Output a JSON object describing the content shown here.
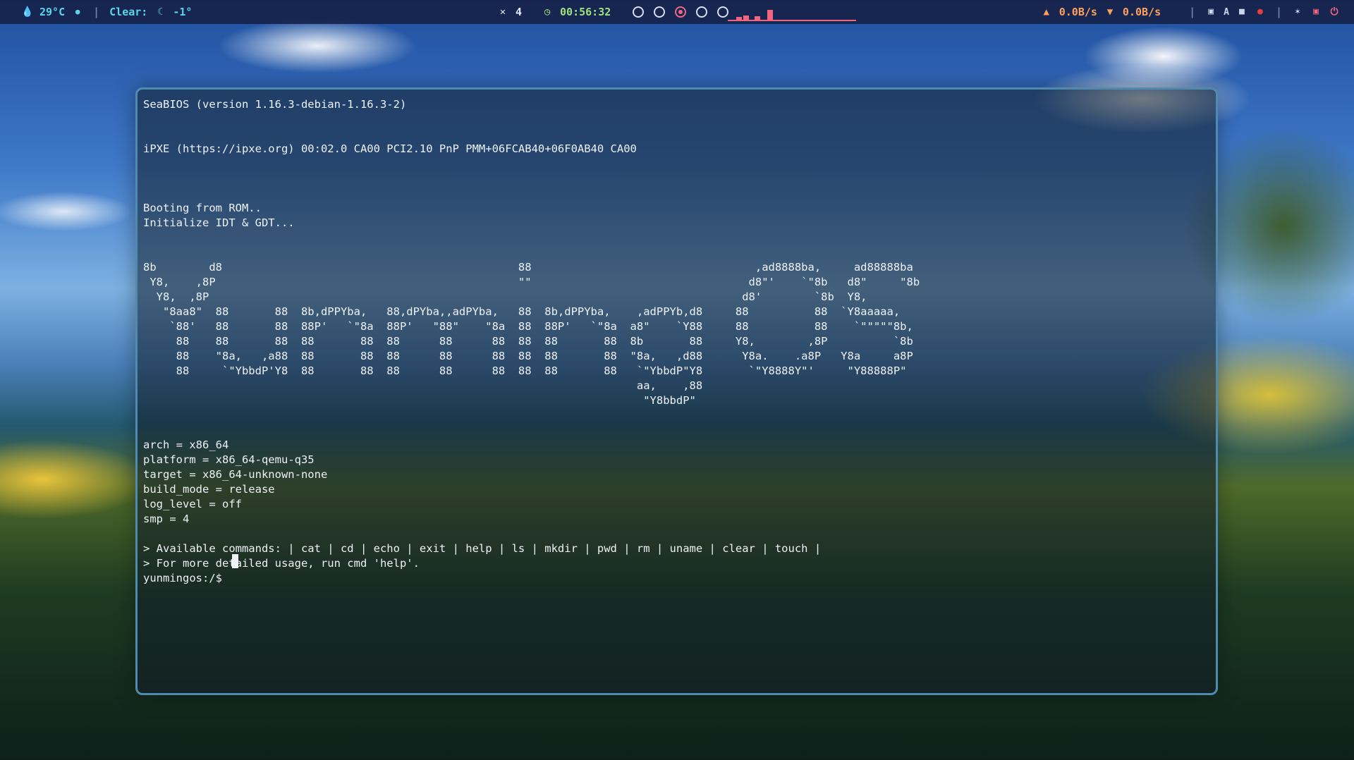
{
  "topbar": {
    "left": {
      "drop_icon": "water-drop-icon",
      "temperature": "29°C",
      "weather_label": "Clear:",
      "weather_icon": "moon-icon",
      "weather_value": "-1°"
    },
    "center": {
      "mute_icon": "mute-icon",
      "mute_count": "4",
      "timer_icon": "clock-icon",
      "timer": "00:56:32",
      "workspaces": [
        "1",
        "2",
        "3",
        "4",
        "5"
      ],
      "active_workspace": "3"
    },
    "right": {
      "upload_icon": "arrow-up-icon",
      "upload_rate": "0.0B/s",
      "download_icon": "arrow-down-icon",
      "download_rate": "0.0B/s",
      "keyboard_layout": "A",
      "power_icon": "power-icon"
    },
    "accent_colors": {
      "bar_bg": "#142046",
      "weather": "#59d6e8",
      "timer": "#9be37a",
      "workspace_active": "#f06680",
      "network": "#ffa05a"
    }
  },
  "terminal": {
    "output": "SeaBIOS (version 1.16.3-debian-1.16.3-2)\n\n\niPXE (https://ipxe.org) 00:02.0 CA00 PCI2.10 PnP PMM+06FCAB40+06F0AB40 CA00\n\n\n\nBooting from ROM..\nInitialize IDT & GDT...\n\n\n8b        d8                                             88                                  ,ad8888ba,     ad88888ba\n Y8,    ,8P                                              \"\"                                 d8\"'    `\"8b   d8\"     \"8b\n  Y8,  ,8P                                                                                 d8'        `8b  Y8,\n   \"8aa8\"  88       88  8b,dPPYba,   88,dPYba,,adPYba,   88  8b,dPPYba,    ,adPPYb,d8     88          88  `Y8aaaaa,\n    `88'   88       88  88P'   `\"8a  88P'   \"88\"    \"8a  88  88P'   `\"8a  a8\"    `Y88     88          88    `\"\"\"\"\"8b,\n     88    88       88  88       88  88      88      88  88  88       88  8b       88     Y8,        ,8P          `8b\n     88    \"8a,   ,a88  88       88  88      88      88  88  88       88  \"8a,   ,d88      Y8a.    .a8P   Y8a     a8P\n     88     `\"YbbdP'Y8  88       88  88      88      88  88  88       88   `\"YbbdP\"Y8       `\"Y8888Y\"'     \"Y88888P\"\n                                                                           aa,    ,88\n                                                                            \"Y8bbdP\"\n\n\narch = x86_64\nplatform = x86_64-qemu-q35\ntarget = x86_64-unknown-none\nbuild_mode = release\nlog_level = off\nsmp = 4\n\n> Available commands: | cat | cd | echo | exit | help | ls | mkdir | pwd | rm | uname | clear | touch |\n> For more detailed usage, run cmd 'help'.\nyunmingos:/$ "
  }
}
